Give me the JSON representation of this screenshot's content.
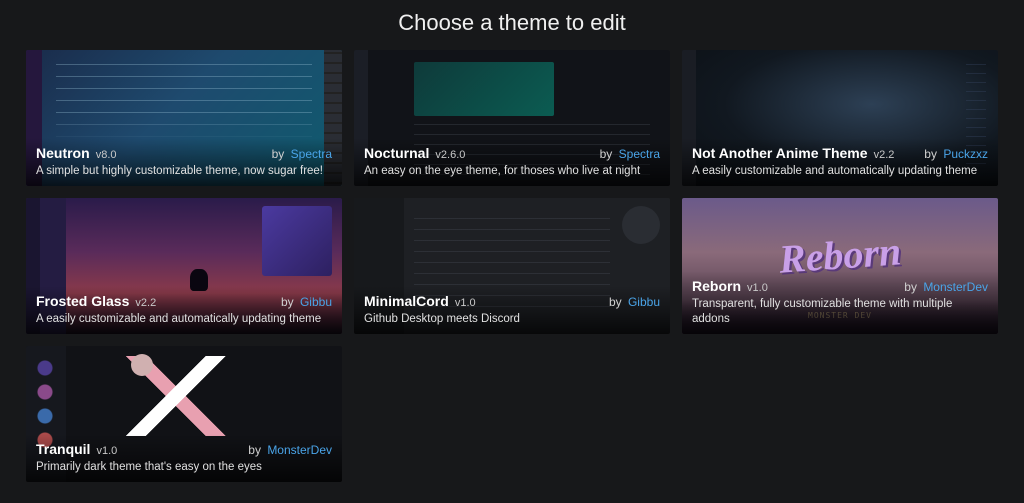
{
  "page_title": "Choose a theme to edit",
  "by_label": "by",
  "themes": [
    {
      "name": "Neutron",
      "version": "v8.0",
      "author": "Spectra",
      "description": "A simple but highly customizable theme, now sugar free!",
      "thumb_class": "thumb-neutron"
    },
    {
      "name": "Nocturnal",
      "version": "v2.6.0",
      "author": "Spectra",
      "description": "An easy on the eye theme, for thoses who live at night",
      "thumb_class": "thumb-nocturnal"
    },
    {
      "name": "Not Another Anime Theme",
      "version": "v2.2",
      "author": "Puckzxz",
      "description": "A easily customizable and automatically updating theme",
      "thumb_class": "thumb-anime"
    },
    {
      "name": "Frosted Glass",
      "version": "v2.2",
      "author": "Gibbu",
      "description": "A easily customizable and automatically updating theme",
      "thumb_class": "thumb-frosted"
    },
    {
      "name": "MinimalCord",
      "version": "v1.0",
      "author": "Gibbu",
      "description": "Github Desktop meets Discord",
      "thumb_class": "thumb-minimal"
    },
    {
      "name": "Reborn",
      "version": "v1.0",
      "author": "MonsterDev",
      "description": "Transparent, fully customizable theme with multiple addons",
      "thumb_class": "thumb-reborn"
    },
    {
      "name": "Tranquil",
      "version": "v1.0",
      "author": "MonsterDev",
      "description": "Primarily dark theme that's easy on the eyes",
      "thumb_class": "thumb-tranquil"
    }
  ]
}
